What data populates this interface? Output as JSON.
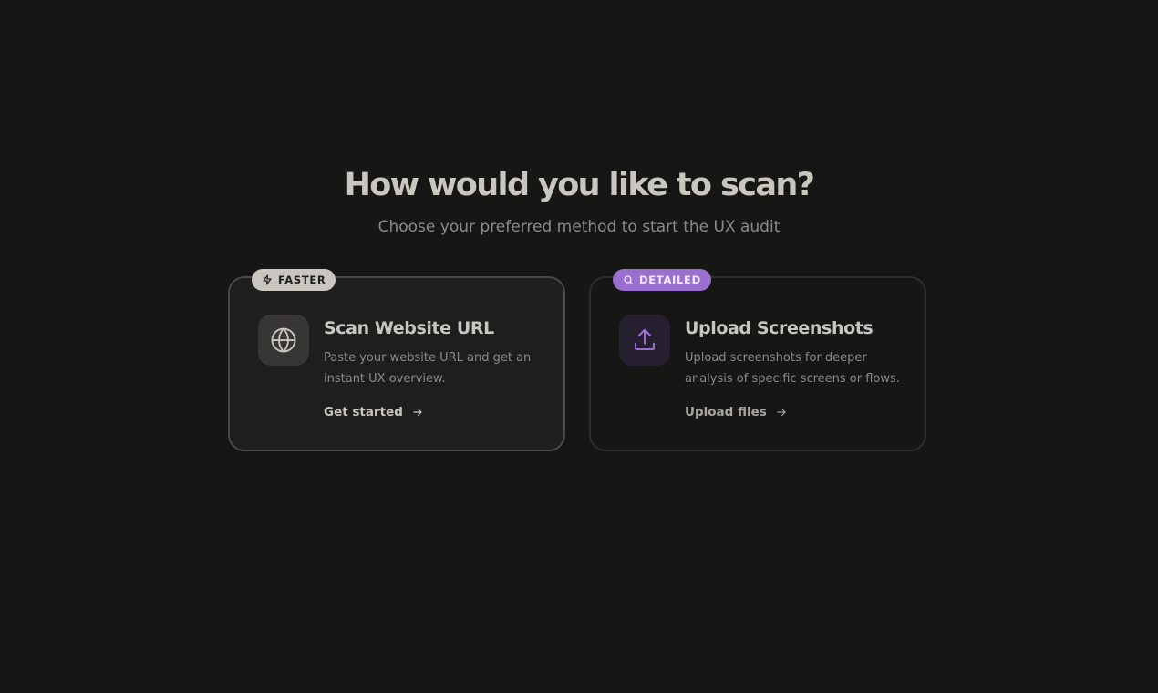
{
  "header": {
    "title": "How would you like to scan?",
    "subtitle": "Choose your preferred method to start the UX audit"
  },
  "options": [
    {
      "badge": "FASTER",
      "badge_icon": "zap-icon",
      "icon": "globe-icon",
      "title": "Scan Website URL",
      "description": "Paste your website URL and get an instant UX overview.",
      "action": "Get started"
    },
    {
      "badge": "DETAILED",
      "badge_icon": "search-icon",
      "icon": "upload-icon",
      "title": "Upload Screenshots",
      "description": "Upload screenshots for deeper analysis of specific screens or flows.",
      "action": "Upload files"
    }
  ],
  "colors": {
    "background": "#161615",
    "text_primary": "#c9c6bf",
    "text_secondary": "#8c8a85",
    "accent_purple": "#9b6fd0"
  }
}
